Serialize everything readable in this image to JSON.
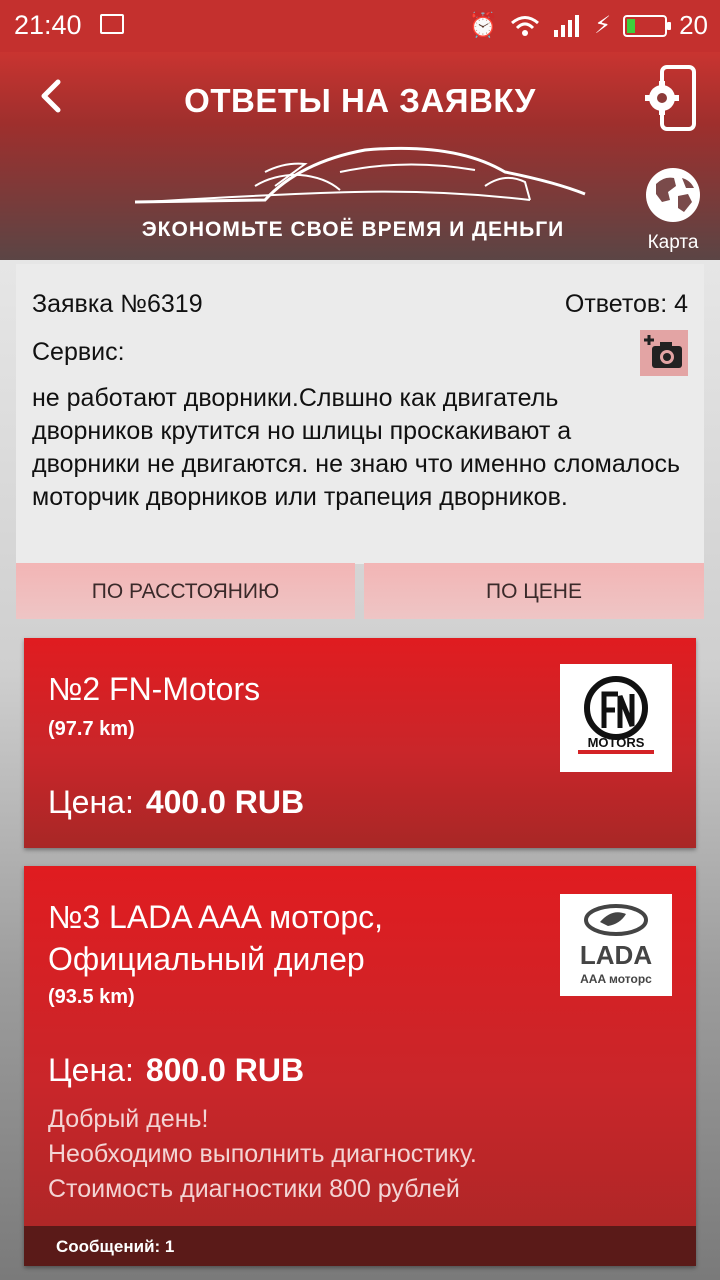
{
  "status_bar": {
    "time": "21:40",
    "battery": "20"
  },
  "header": {
    "title": "ОТВЕТЫ НА ЗАЯВКУ",
    "slogan": "ЭКОНОМЬТЕ СВОЁ ВРЕМЯ И ДЕНЬГИ",
    "map_label": "Карта"
  },
  "request": {
    "number": "Заявка №6319",
    "answers": "Ответов: 4",
    "service": "Сервис:",
    "text": "не работают дворники.Слвшно как двигатель дворников крутится но шлицы проскакивают а дворники не двигаются. не знаю что именно сломалось моторчик дворников или трапеция дворников."
  },
  "sort": {
    "by_distance": "ПО РАССТОЯНИЮ",
    "by_price": "ПО ЦЕНЕ"
  },
  "offers": [
    {
      "name": "№2 FN-Motors",
      "distance": "(97.7 km)",
      "price_label": "Цена:",
      "price": "400.0 RUB",
      "logo_text": "MOTORS"
    },
    {
      "name": "№3 LADA AAA моторс, Официальный дилер",
      "distance": "(93.5 km)",
      "price_label": "Цена:",
      "price": "800.0 RUB",
      "message": "Добрый день!\nНеобходимо выполнить диагностику.\nСтоимость диагностики 800 рублей",
      "messages_count": "Сообщений: 1",
      "logo_text": "LADA",
      "logo_subtext": "AAA моторс"
    }
  ],
  "colors": {
    "status_bar": "#c4302e",
    "card": "#d42226",
    "sort_button": "#f0b8b8",
    "footer": "#5a1a18"
  },
  "icons": [
    "image-icon",
    "alarm-icon",
    "wifi-icon",
    "signal-icon",
    "charging-icon",
    "battery-icon",
    "back-icon",
    "settings-phone-icon",
    "globe-icon",
    "add-photo-icon"
  ]
}
